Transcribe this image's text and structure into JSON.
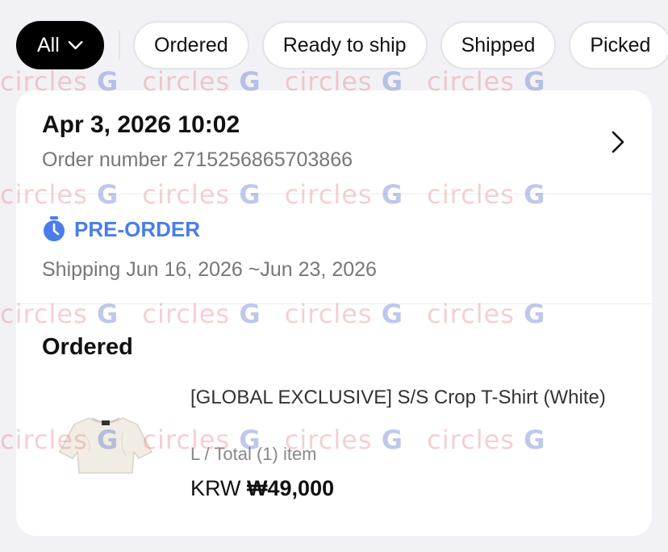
{
  "filters": {
    "active_label": "All",
    "chips": [
      "Ordered",
      "Ready to ship",
      "Shipped",
      "Picked"
    ]
  },
  "order": {
    "date": "Apr 3, 2026 10:02",
    "number_label": "Order number 2715256865703866",
    "preorder_label": "PRE-ORDER",
    "shipping_label": "Shipping Jun 16, 2026 ~Jun 23, 2026",
    "status": "Ordered",
    "product": {
      "name": "[GLOBAL EXCLUSIVE] S/S Crop T-Shirt (White)",
      "option": "L / Total (1) item",
      "currency": "KRW",
      "price": "₩49,000"
    }
  },
  "watermark": {
    "text": "circles",
    "mark": "G"
  },
  "icons": {
    "filter_chevron": "chevron-down-icon",
    "order_chevron": "chevron-right-icon",
    "preorder": "timer-icon"
  },
  "colors": {
    "accent": "#4a7de8",
    "active_chip": "#000000"
  }
}
